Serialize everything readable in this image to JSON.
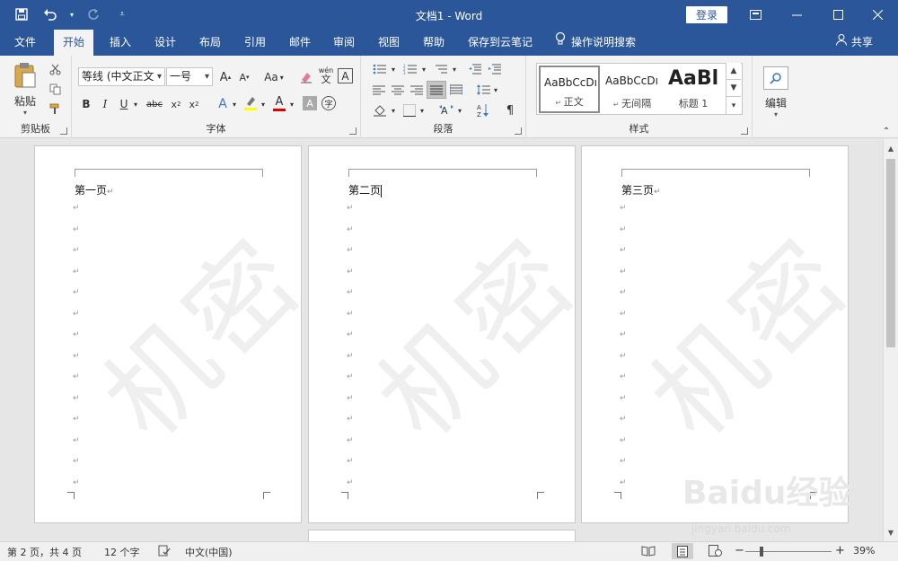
{
  "window": {
    "title": "文档1 - Word",
    "login_label": "登录"
  },
  "tabs": [
    {
      "label": "文件"
    },
    {
      "label": "开始"
    },
    {
      "label": "插入"
    },
    {
      "label": "设计"
    },
    {
      "label": "布局"
    },
    {
      "label": "引用"
    },
    {
      "label": "邮件"
    },
    {
      "label": "审阅"
    },
    {
      "label": "视图"
    },
    {
      "label": "帮助"
    },
    {
      "label": "保存到云笔记"
    }
  ],
  "active_tab": "开始",
  "tell_me": "操作说明搜索",
  "share_label": "共享",
  "ribbon": {
    "clipboard": {
      "label": "剪贴板",
      "paste_label": "粘贴"
    },
    "font": {
      "label": "字体",
      "font_name": "等线 (中文正文",
      "font_size": "一号",
      "change_case": "Aa",
      "strikethrough": "abc",
      "phonetic": "wén"
    },
    "paragraph": {
      "label": "段落"
    },
    "styles": {
      "label": "样式",
      "items": [
        {
          "sample": "AaBbCcDı",
          "name": "正文"
        },
        {
          "sample": "AaBbCcDı",
          "name": "无间隔"
        },
        {
          "sample": "AaBl",
          "name": "标题 1"
        }
      ]
    },
    "editing": {
      "label": "编辑"
    }
  },
  "pages": [
    {
      "heading": "第一页",
      "paragraph_marks": 14
    },
    {
      "heading": "第二页",
      "paragraph_marks": 14
    },
    {
      "heading": "第三页",
      "paragraph_marks": 14
    }
  ],
  "watermark_text": "机密",
  "status": {
    "page": "第 2 页，共 4 页",
    "words": "12 个字",
    "language": "中文(中国)",
    "zoom": "39%"
  },
  "brand": {
    "text": "Baidu经验",
    "url": "jingyan.baidu.com"
  }
}
